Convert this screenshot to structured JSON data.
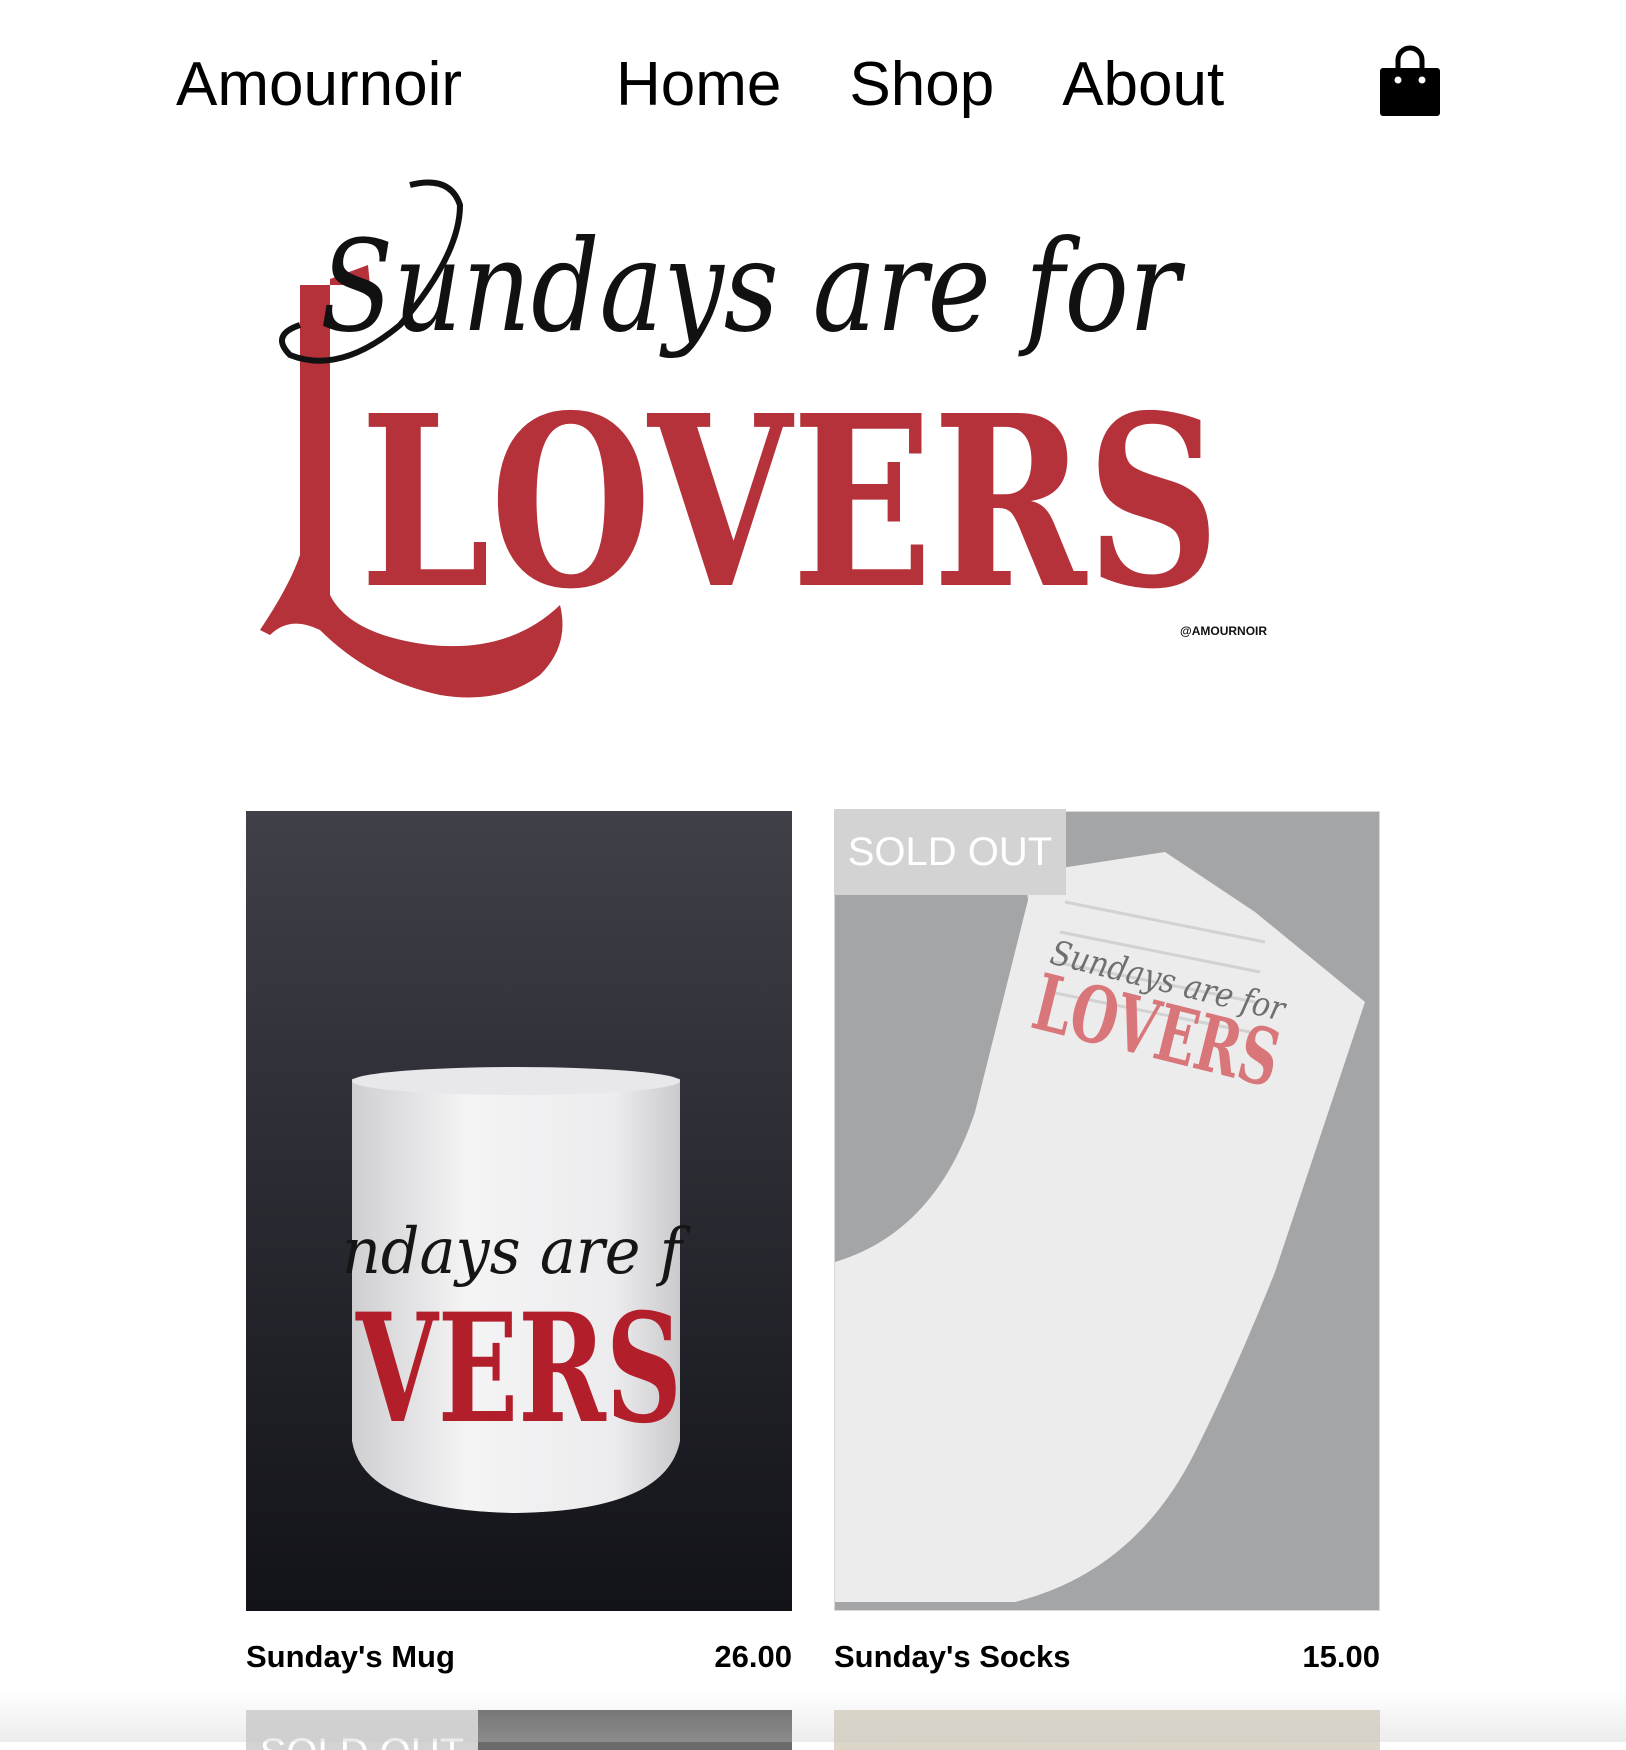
{
  "nav": {
    "brand": "Amournoir",
    "links": [
      "Home",
      "Shop",
      "About"
    ],
    "cart_icon": "shopping-bag-icon"
  },
  "hero": {
    "script_line": "Sundays are for",
    "main_word": "LOVERS",
    "handle": "@AMOURNOIR",
    "accent_color": "#b5323a"
  },
  "products": [
    {
      "name": "Sunday's Mug",
      "price": "26.00",
      "sold_out": false,
      "print_script": "ndays are f",
      "print_main": "VERS"
    },
    {
      "name": "Sunday's Socks",
      "price": "15.00",
      "sold_out": true,
      "badge": "SOLD OUT",
      "print_script": "Sundays are for",
      "print_main": "LOVERS"
    }
  ],
  "next_row": {
    "badge": "SOLD OUT"
  }
}
